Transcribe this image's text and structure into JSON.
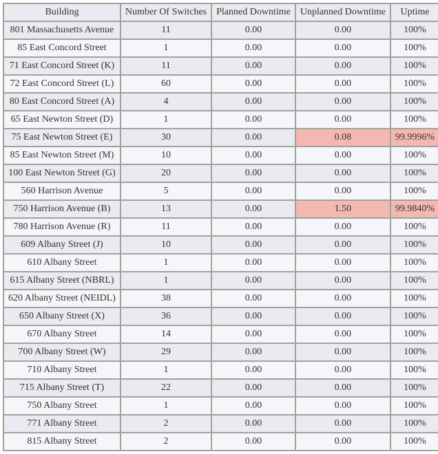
{
  "chart_data": {
    "type": "table",
    "columns": [
      "Building",
      "Number Of Switches",
      "Planned Downtime",
      "Unplanned Downtime",
      "Uptime"
    ],
    "rows": [
      {
        "building": "801 Massachusetts Avenue",
        "switches": "11",
        "planned": "0.00",
        "unplanned": "0.00",
        "uptime": "100%",
        "hl_unplanned": false,
        "hl_uptime": false
      },
      {
        "building": "85 East Concord Street",
        "switches": "1",
        "planned": "0.00",
        "unplanned": "0.00",
        "uptime": "100%",
        "hl_unplanned": false,
        "hl_uptime": false
      },
      {
        "building": "71 East Concord Street (K)",
        "switches": "11",
        "planned": "0.00",
        "unplanned": "0.00",
        "uptime": "100%",
        "hl_unplanned": false,
        "hl_uptime": false
      },
      {
        "building": "72 East Concord Street (L)",
        "switches": "60",
        "planned": "0.00",
        "unplanned": "0.00",
        "uptime": "100%",
        "hl_unplanned": false,
        "hl_uptime": false
      },
      {
        "building": "80 East Concord Street (A)",
        "switches": "4",
        "planned": "0.00",
        "unplanned": "0.00",
        "uptime": "100%",
        "hl_unplanned": false,
        "hl_uptime": false
      },
      {
        "building": "65 East Newton Street (D)",
        "switches": "1",
        "planned": "0.00",
        "unplanned": "0.00",
        "uptime": "100%",
        "hl_unplanned": false,
        "hl_uptime": false
      },
      {
        "building": "75 East Newton Street (E)",
        "switches": "30",
        "planned": "0.00",
        "unplanned": "0.08",
        "uptime": "99.9996%",
        "hl_unplanned": true,
        "hl_uptime": true
      },
      {
        "building": "85 East Newton Street (M)",
        "switches": "10",
        "planned": "0.00",
        "unplanned": "0.00",
        "uptime": "100%",
        "hl_unplanned": false,
        "hl_uptime": false
      },
      {
        "building": "100 East Newton Street (G)",
        "switches": "20",
        "planned": "0.00",
        "unplanned": "0.00",
        "uptime": "100%",
        "hl_unplanned": false,
        "hl_uptime": false
      },
      {
        "building": "560 Harrison Avenue",
        "switches": "5",
        "planned": "0.00",
        "unplanned": "0.00",
        "uptime": "100%",
        "hl_unplanned": false,
        "hl_uptime": false
      },
      {
        "building": "750 Harrison Avenue (B)",
        "switches": "13",
        "planned": "0.00",
        "unplanned": "1.50",
        "uptime": "99.9840%",
        "hl_unplanned": true,
        "hl_uptime": true
      },
      {
        "building": "780 Harrison Avenue (R)",
        "switches": "11",
        "planned": "0.00",
        "unplanned": "0.00",
        "uptime": "100%",
        "hl_unplanned": false,
        "hl_uptime": false
      },
      {
        "building": "609 Albany Street (J)",
        "switches": "10",
        "planned": "0.00",
        "unplanned": "0.00",
        "uptime": "100%",
        "hl_unplanned": false,
        "hl_uptime": false
      },
      {
        "building": "610 Albany Street",
        "switches": "1",
        "planned": "0.00",
        "unplanned": "0.00",
        "uptime": "100%",
        "hl_unplanned": false,
        "hl_uptime": false
      },
      {
        "building": "615 Albany Street (NBRL)",
        "switches": "1",
        "planned": "0.00",
        "unplanned": "0.00",
        "uptime": "100%",
        "hl_unplanned": false,
        "hl_uptime": false
      },
      {
        "building": "620 Albany Street (NEIDL)",
        "switches": "38",
        "planned": "0.00",
        "unplanned": "0.00",
        "uptime": "100%",
        "hl_unplanned": false,
        "hl_uptime": false
      },
      {
        "building": "650 Albany Street (X)",
        "switches": "36",
        "planned": "0.00",
        "unplanned": "0.00",
        "uptime": "100%",
        "hl_unplanned": false,
        "hl_uptime": false
      },
      {
        "building": "670 Albany Street",
        "switches": "14",
        "planned": "0.00",
        "unplanned": "0.00",
        "uptime": "100%",
        "hl_unplanned": false,
        "hl_uptime": false
      },
      {
        "building": "700 Albany Street (W)",
        "switches": "29",
        "planned": "0.00",
        "unplanned": "0.00",
        "uptime": "100%",
        "hl_unplanned": false,
        "hl_uptime": false
      },
      {
        "building": "710 Albany Street",
        "switches": "1",
        "planned": "0.00",
        "unplanned": "0.00",
        "uptime": "100%",
        "hl_unplanned": false,
        "hl_uptime": false
      },
      {
        "building": "715 Albany Street (T)",
        "switches": "22",
        "planned": "0.00",
        "unplanned": "0.00",
        "uptime": "100%",
        "hl_unplanned": false,
        "hl_uptime": false
      },
      {
        "building": "750 Albany Street",
        "switches": "1",
        "planned": "0.00",
        "unplanned": "0.00",
        "uptime": "100%",
        "hl_unplanned": false,
        "hl_uptime": false
      },
      {
        "building": "771 Albany Street",
        "switches": "2",
        "planned": "0.00",
        "unplanned": "0.00",
        "uptime": "100%",
        "hl_unplanned": false,
        "hl_uptime": false
      },
      {
        "building": "815 Albany Street",
        "switches": "2",
        "planned": "0.00",
        "unplanned": "0.00",
        "uptime": "100%",
        "hl_unplanned": false,
        "hl_uptime": false
      }
    ]
  }
}
